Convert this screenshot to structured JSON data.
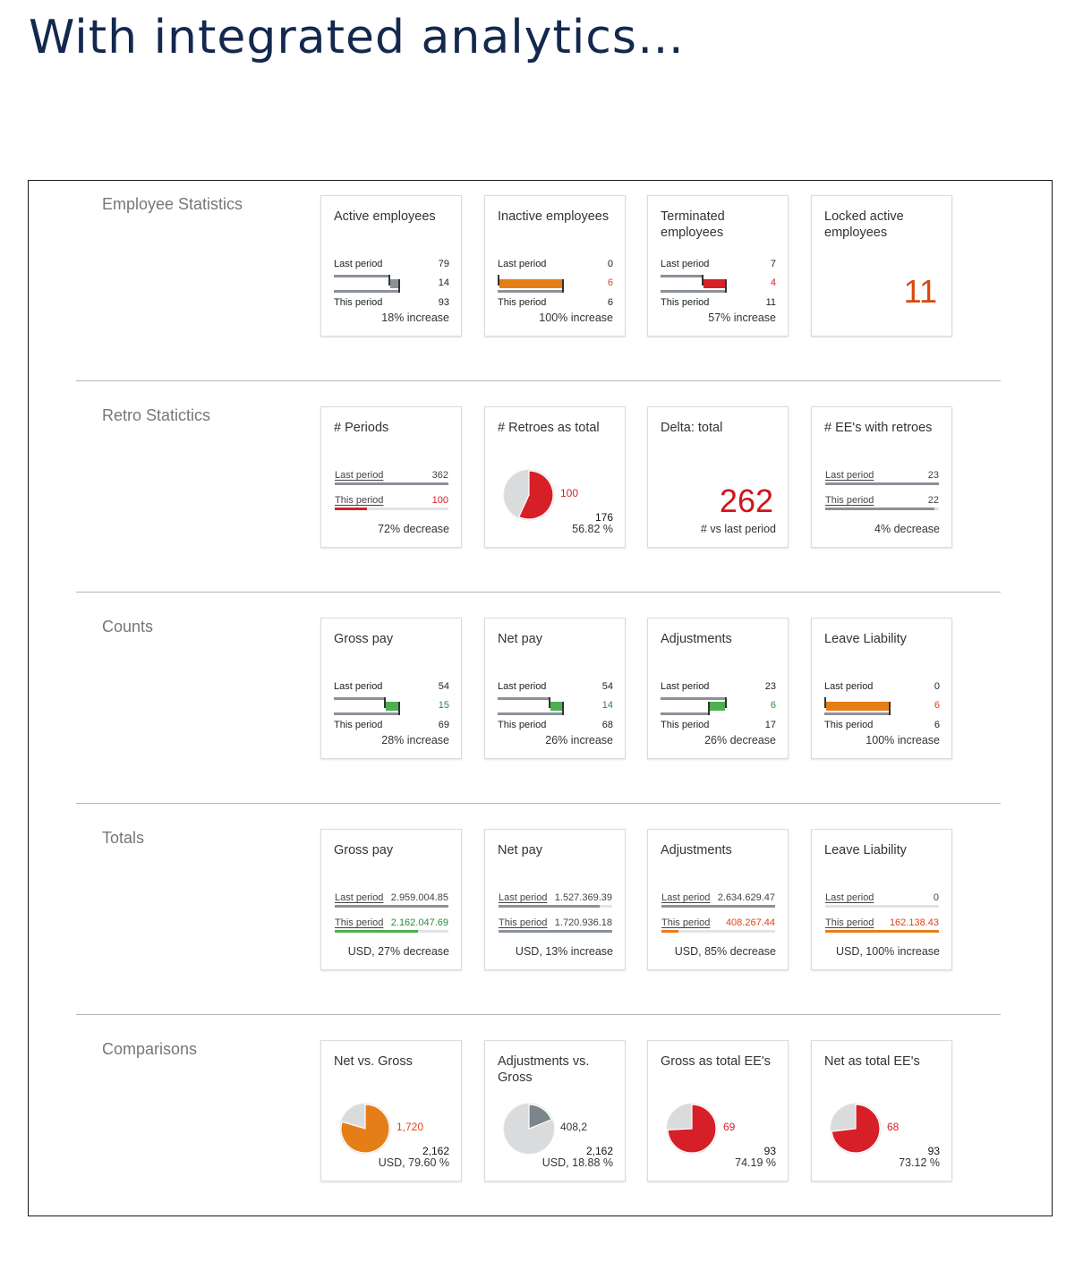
{
  "headline": "With integrated analytics…",
  "colors": {
    "gray": "#8a9199",
    "orange": "#e67e17",
    "red": "#d61f26",
    "green": "#4caf50",
    "light": "#d9dbdd",
    "dark_gray": "#7b858c"
  },
  "labels": {
    "last": "Last period",
    "this": "This period"
  },
  "sections": [
    {
      "label": "Employee Statistics",
      "cards": [
        {
          "type": "bullet",
          "title": "Active employees",
          "last": 79,
          "delta": "14",
          "this": 93,
          "delta_color": "gray",
          "delta_text_color": "#222",
          "summary": "18% increase"
        },
        {
          "type": "bullet",
          "title": "Inactive employees",
          "last": 0,
          "delta": "6",
          "this": 6,
          "delta_color": "orange",
          "delta_text_color": "#e0431b",
          "summary": "100% increase"
        },
        {
          "type": "bullet",
          "title": "Terminated employees",
          "last": 7,
          "delta": "4",
          "this": 11,
          "delta_color": "red",
          "delta_text_color": "#d61f26",
          "summary": "57% increase"
        },
        {
          "type": "big",
          "title": "Locked active employees",
          "value": "11",
          "value_color": "#d9480f",
          "summary": ""
        }
      ]
    },
    {
      "label": "Retro Statictics",
      "cards": [
        {
          "type": "lines",
          "title": "# Periods",
          "last_text": "362",
          "this_text": "100",
          "last_frac": 1.0,
          "this_frac": 0.28,
          "last_color": "gray",
          "this_color": "red",
          "this_text_color": "#d61f26",
          "summary": "72% decrease"
        },
        {
          "type": "pie",
          "title": "# Retroes as total",
          "part": "100",
          "total": "176",
          "frac": 0.5682,
          "pie_color": "red",
          "part_color": "#d61f26",
          "summary": "56.82 %"
        },
        {
          "type": "big",
          "title": "Delta: total",
          "value": "262",
          "value_color": "#d0141b",
          "summary": "# vs last period"
        },
        {
          "type": "lines",
          "title": "# EE's with retroes",
          "last_text": "23",
          "this_text": "22",
          "last_frac": 1.0,
          "this_frac": 0.96,
          "last_color": "gray",
          "this_color": "gray",
          "this_text_color": "#444",
          "summary": "4% decrease"
        }
      ]
    },
    {
      "label": "Counts",
      "cards": [
        {
          "type": "bullet",
          "title": "Gross pay",
          "last": 54,
          "delta": "15",
          "this": 69,
          "delta_color": "green",
          "delta_text_color": "#2e8b3a",
          "summary": "28% increase"
        },
        {
          "type": "bullet",
          "title": "Net pay",
          "last": 54,
          "delta": "14",
          "this": 68,
          "delta_color": "green",
          "delta_text_color": "#2e8b3a",
          "summary": "26% increase"
        },
        {
          "type": "bullet",
          "title": "Adjustments",
          "last": 23,
          "delta": "6",
          "this": 17,
          "delta_color": "green",
          "delta_text_color": "#2e8b3a",
          "summary": "26% decrease"
        },
        {
          "type": "bullet",
          "title": "Leave Liability",
          "last": 0,
          "delta": "6",
          "this": 6,
          "delta_color": "orange",
          "delta_text_color": "#e0431b",
          "summary": "100% increase"
        }
      ]
    },
    {
      "label": "Totals",
      "cards": [
        {
          "type": "lines",
          "title": "Gross pay",
          "last_text": "2.959.004.85",
          "this_text": "2.162.047.69",
          "last_frac": 1.0,
          "this_frac": 0.73,
          "last_color": "gray",
          "this_color": "green",
          "this_text_color": "#2e8b3a",
          "summary": "USD, 27% decrease"
        },
        {
          "type": "lines",
          "title": "Net pay",
          "last_text": "1.527.369.39",
          "this_text": "1.720.936.18",
          "last_frac": 0.89,
          "this_frac": 1.0,
          "last_color": "gray",
          "this_color": "gray",
          "this_text_color": "#444",
          "summary": "USD, 13% increase"
        },
        {
          "type": "lines",
          "title": "Adjustments",
          "last_text": "2.634.629.47",
          "this_text": "408.267.44",
          "last_frac": 1.0,
          "this_frac": 0.15,
          "last_color": "gray",
          "this_color": "orange",
          "this_text_color": "#e0431b",
          "summary": "USD, 85% decrease"
        },
        {
          "type": "lines",
          "title": "Leave Liability",
          "last_text": "0",
          "this_text": "162.138.43",
          "last_frac": 0.0,
          "this_frac": 1.0,
          "last_color": "gray",
          "this_color": "orange",
          "this_text_color": "#e0431b",
          "summary": "USD, 100% increase"
        }
      ]
    },
    {
      "label": "Comparisons",
      "cards": [
        {
          "type": "pie",
          "title": "Net vs. Gross",
          "part": "1,720",
          "total": "2,162",
          "frac": 0.796,
          "pie_color": "orange",
          "part_color": "#e0431b",
          "summary": "USD, 79.60 %"
        },
        {
          "type": "pie",
          "title": "Adjustments vs. Gross",
          "part": "408,2",
          "total": "2,162",
          "frac": 0.1888,
          "pie_color": "dark_gray",
          "part_color": "#333",
          "summary": "USD, 18.88 %"
        },
        {
          "type": "pie",
          "title": "Gross as total EE's",
          "part": "69",
          "total": "93",
          "frac": 0.7419,
          "pie_color": "red",
          "part_color": "#d61f26",
          "summary": "74.19 %"
        },
        {
          "type": "pie",
          "title": "Net as total EE's",
          "part": "68",
          "total": "93",
          "frac": 0.7312,
          "pie_color": "red",
          "part_color": "#d61f26",
          "summary": "73.12 %"
        }
      ]
    }
  ]
}
